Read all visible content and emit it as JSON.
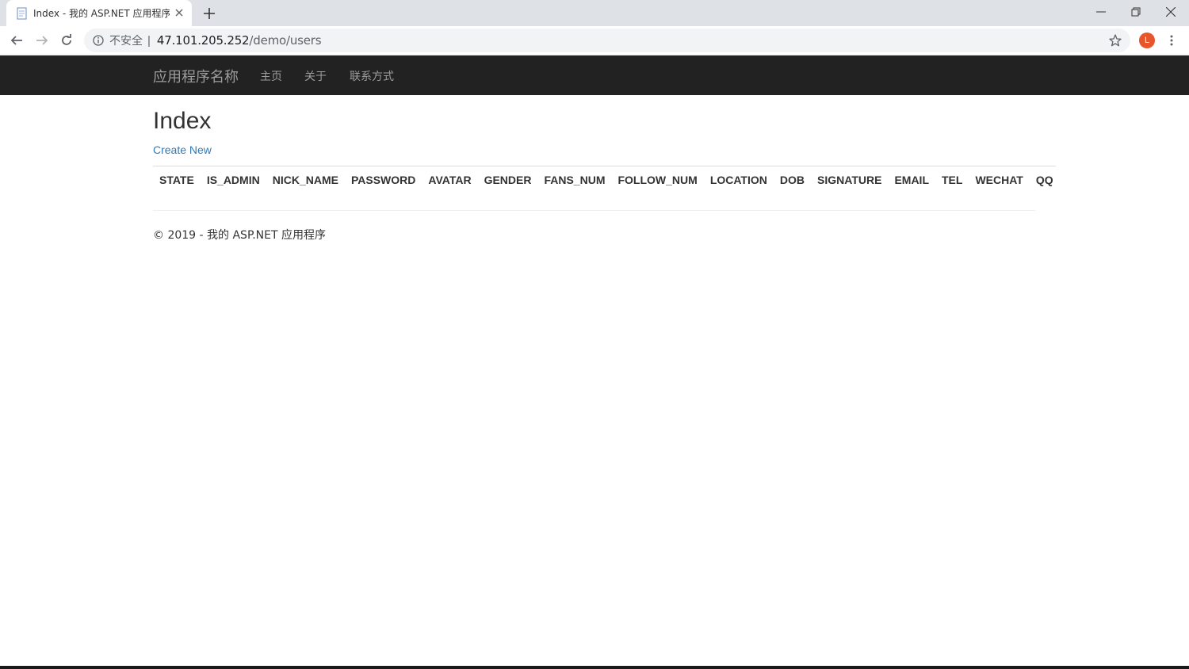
{
  "browser": {
    "tab_title": "Index - 我的 ASP.NET 应用程序",
    "insecure_label": "不安全",
    "url_host": "47.101.205.252",
    "url_path": "/demo/users",
    "profile_initial": "L"
  },
  "navbar": {
    "brand": "应用程序名称",
    "links": [
      "主页",
      "关于",
      "联系方式"
    ]
  },
  "main": {
    "title": "Index",
    "create_link": "Create New",
    "table_headers": [
      "STATE",
      "IS_ADMIN",
      "NICK_NAME",
      "PASSWORD",
      "AVATAR",
      "GENDER",
      "FANS_NUM",
      "FOLLOW_NUM",
      "LOCATION",
      "DOB",
      "SIGNATURE",
      "EMAIL",
      "TEL",
      "WECHAT",
      "QQ"
    ]
  },
  "footer": {
    "text": "© 2019 - 我的 ASP.NET 应用程序"
  },
  "colors": {
    "navbar_bg": "#222222",
    "nav_text": "#9d9d9d",
    "link": "#337ab7",
    "profile": "#e8552b"
  }
}
